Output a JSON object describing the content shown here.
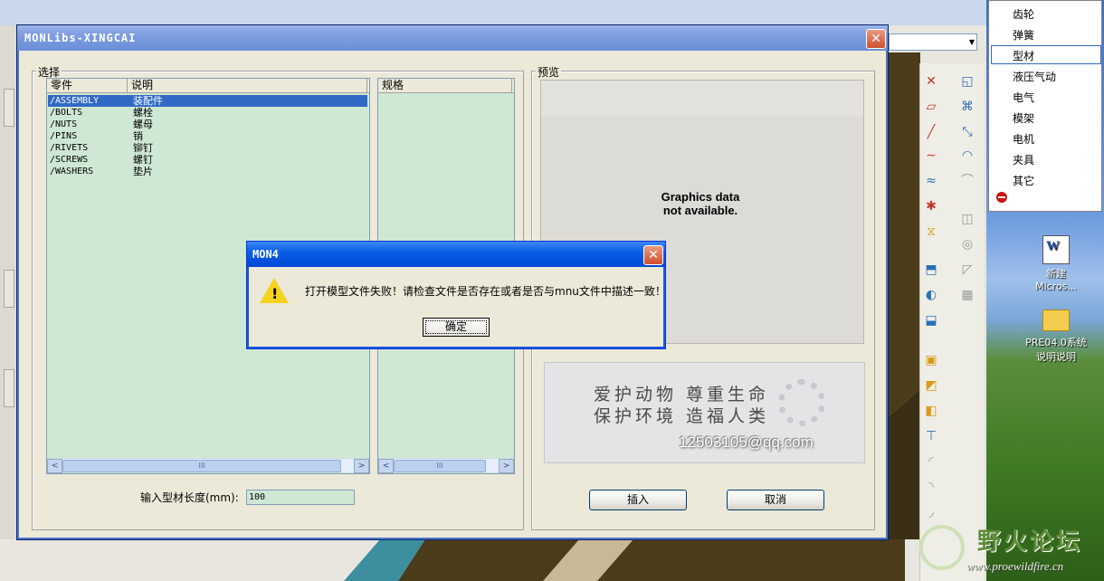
{
  "main_window": {
    "title": "MONLibs-XINGCAI",
    "close_glyph": "✕",
    "select_group_label": "选择",
    "preview_group_label": "预览",
    "parts_list": {
      "columns": [
        "零件",
        "说明"
      ],
      "rows": [
        {
          "part": "/ASSEMBLY",
          "desc": "装配件",
          "selected": true
        },
        {
          "part": "/BOLTS",
          "desc": "螺栓",
          "selected": false
        },
        {
          "part": "/NUTS",
          "desc": "螺母",
          "selected": false
        },
        {
          "part": "/PINS",
          "desc": "销",
          "selected": false
        },
        {
          "part": "/RIVETS",
          "desc": "铆钉",
          "selected": false
        },
        {
          "part": "/SCREWS",
          "desc": "螺钉",
          "selected": false
        },
        {
          "part": "/WASHERS",
          "desc": "垫片",
          "selected": false
        }
      ]
    },
    "spec_list": {
      "header": "规格"
    },
    "scroll": {
      "left_arrow": "<",
      "right_arrow": ">",
      "thumb_grip": "III"
    },
    "preview_message_line1": "Graphics data",
    "preview_message_line2": "not available.",
    "watermark": {
      "line1": "爱护动物 尊重生命",
      "line2": "保护环境 造福人类",
      "email": "12503105@qq.com"
    },
    "length_label": "输入型材长度(mm):",
    "length_value": "100",
    "insert_button": "插入",
    "cancel_button": "取消"
  },
  "error_dialog": {
    "title": "MON4",
    "message": "打开模型文件失败！请检查文件是否存在或者是否与mnu文件中描述一致！",
    "ok_button": "确定",
    "close_glyph": "✕"
  },
  "side_menu": {
    "items": [
      "齿轮",
      "弹簧",
      "型材",
      "液压气动",
      "电气",
      "模架",
      "电机",
      "夹具",
      "其它"
    ],
    "selected": "型材"
  },
  "desktop": {
    "icons": [
      {
        "label_line1": "新建",
        "label_line2": "Micros...",
        "icon": "word-document-icon",
        "glyph": "W"
      },
      {
        "label_line1": "PRE04.0系统",
        "label_line2": "说明说明",
        "icon": "folder-icon"
      }
    ]
  },
  "forum_watermark": {
    "name": "野火论坛",
    "url": "www.proewildfire.cn"
  },
  "colors": {
    "list_background": "#cfe8d4",
    "selection": "#316ac5",
    "dialog_title": "#0a5ee6",
    "main_title": "#7d9de0"
  }
}
